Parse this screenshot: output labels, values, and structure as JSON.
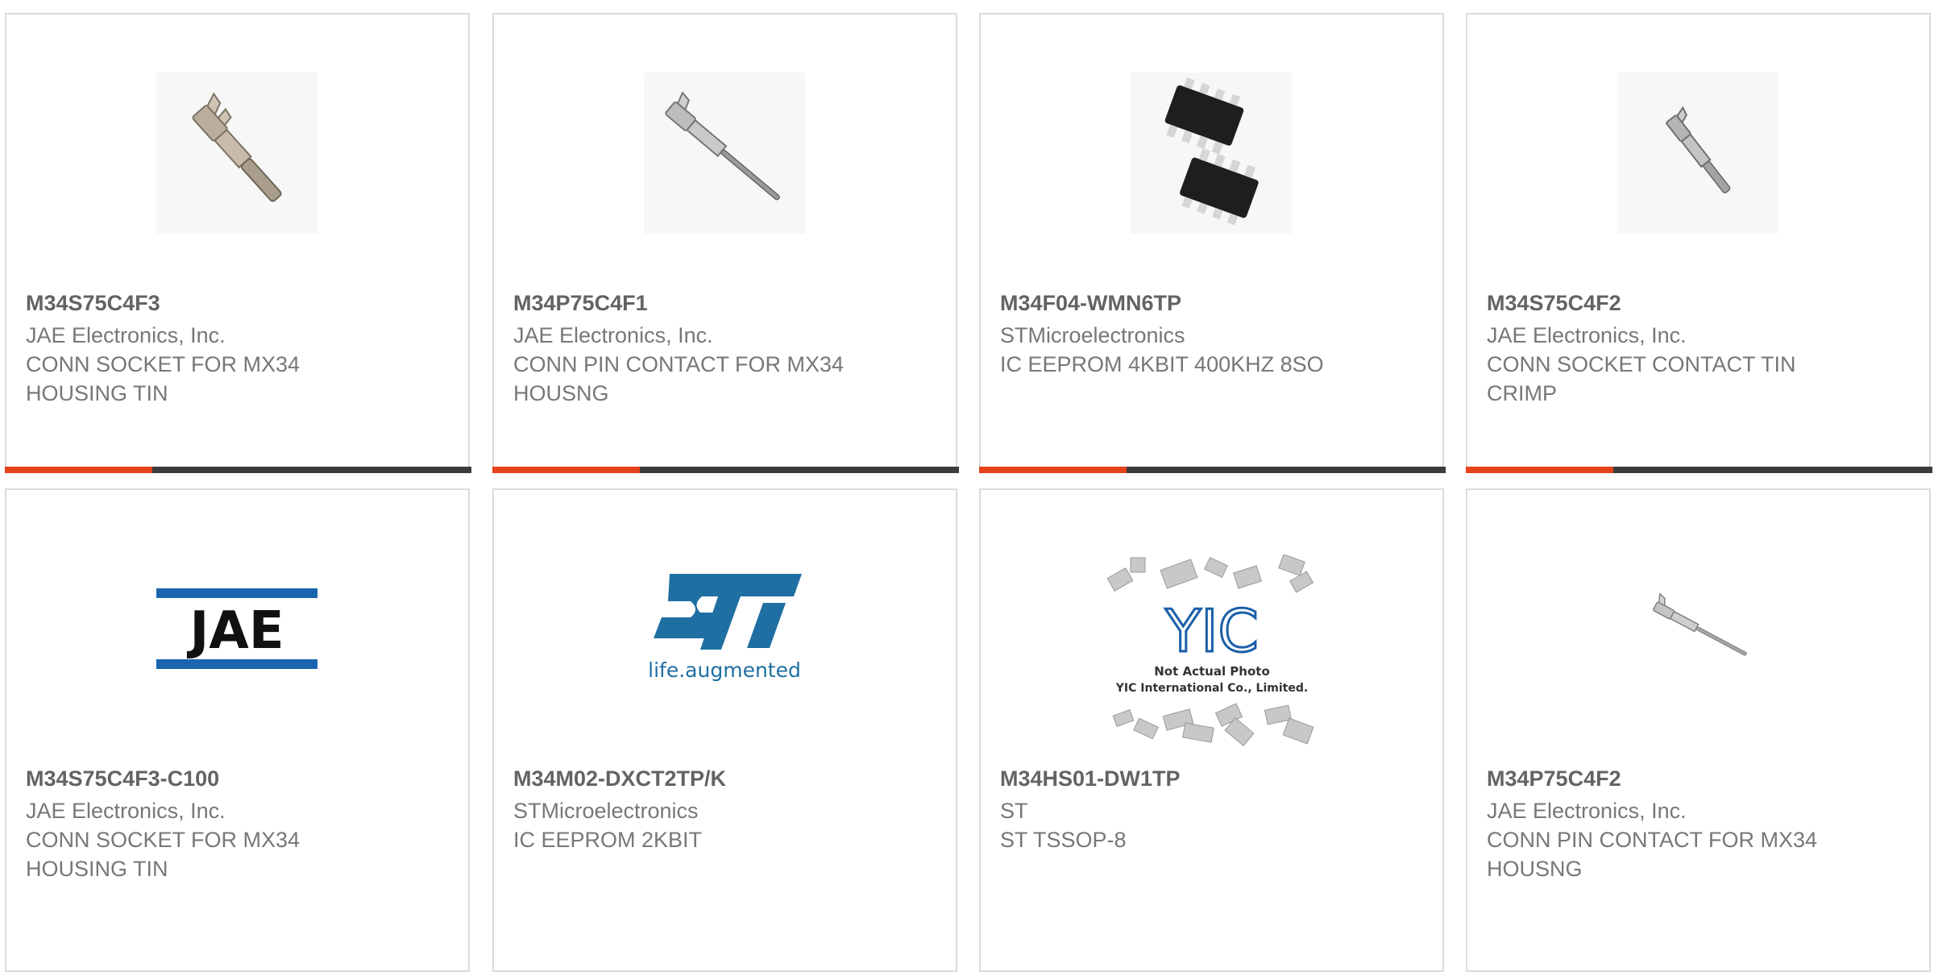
{
  "products": [
    {
      "part": "M34S75C4F3",
      "manufacturer": "JAE Electronics, Inc.",
      "description": "CONN SOCKET FOR MX34 HOUSING TIN",
      "image": "crimp-socket-contact"
    },
    {
      "part": "M34P75C4F1",
      "manufacturer": "JAE Electronics, Inc.",
      "description": "CONN PIN CONTACT FOR MX34 HOUSNG",
      "image": "pin-contact"
    },
    {
      "part": "M34F04-WMN6TP",
      "manufacturer": "STMicroelectronics",
      "description": "IC EEPROM 4KBIT 400KHZ 8SO",
      "image": "so8-ic-package"
    },
    {
      "part": "M34S75C4F2",
      "manufacturer": "JAE Electronics, Inc.",
      "description": "CONN SOCKET CONTACT TIN CRIMP",
      "image": "crimp-socket-contact-small"
    },
    {
      "part": "M34S75C4F3-C100",
      "manufacturer": "JAE Electronics, Inc.",
      "description": "CONN SOCKET FOR MX34 HOUSING TIN",
      "image": "jae-logo",
      "logo_text": "JAE"
    },
    {
      "part": "M34M02-DXCT2TP/K",
      "manufacturer": "STMicroelectronics",
      "description": "IC EEPROM 2KBIT",
      "image": "st-logo",
      "logo_text": "life.augmented"
    },
    {
      "part": "M34HS01-DW1TP",
      "manufacturer": "ST",
      "description": "ST TSSOP-8",
      "image": "yic-placeholder",
      "logo_text": "YIC",
      "photo_note": [
        "Not Actual Photo",
        "YIC International Co., Limited."
      ]
    },
    {
      "part": "M34P75C4F2",
      "manufacturer": "JAE Electronics, Inc.",
      "description": "CONN PIN CONTACT FOR MX34 HOUSNG",
      "image": "pin-contact-small"
    }
  ],
  "colors": {
    "accent": "#e6421b",
    "bar": "#3c3c3c",
    "border": "#dcdcdc",
    "text": "#777777",
    "part": "#636363",
    "jae_blue": "#1a64b0",
    "st_blue": "#1f6fa3"
  }
}
